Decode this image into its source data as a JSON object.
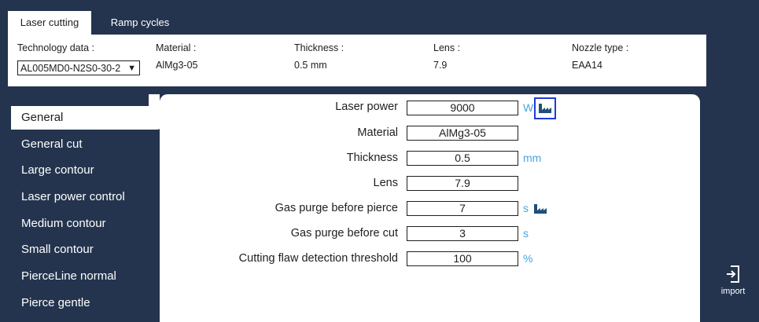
{
  "tabs": [
    {
      "label": "Laser cutting",
      "active": true
    },
    {
      "label": "Ramp cycles",
      "active": false
    }
  ],
  "technology": {
    "label": "Technology data :",
    "selected": "AL005MD0-N2S0-30-2",
    "material_label": "Material :",
    "material_value": "AlMg3-05",
    "thickness_label": "Thickness :",
    "thickness_value": "0.5 mm",
    "lens_label": "Lens :",
    "lens_value": "7.9",
    "nozzle_label": "Nozzle type :",
    "nozzle_value": "EAA14"
  },
  "sidebar": {
    "items": [
      {
        "label": "General",
        "active": true
      },
      {
        "label": "General cut"
      },
      {
        "label": "Large contour"
      },
      {
        "label": "Laser power control"
      },
      {
        "label": "Medium contour"
      },
      {
        "label": "Small contour"
      },
      {
        "label": "PierceLine normal"
      },
      {
        "label": "Pierce gentle"
      }
    ]
  },
  "parameters": [
    {
      "label": "Laser power",
      "value": "9000",
      "unit": "W",
      "icon": "factory-icon"
    },
    {
      "label": "Material",
      "value": "AlMg3-05",
      "unit": ""
    },
    {
      "label": "Thickness",
      "value": "0.5",
      "unit": "mm"
    },
    {
      "label": "Lens",
      "value": "7.9",
      "unit": ""
    },
    {
      "label": "Gas purge before pierce",
      "value": "7",
      "unit": "s",
      "icon": "factory-icon"
    },
    {
      "label": "Gas purge before cut",
      "value": "3",
      "unit": "s"
    },
    {
      "label": "Cutting flaw detection threshold",
      "value": "100",
      "unit": "%"
    }
  ],
  "actions": {
    "import_label": "import",
    "import_icon": "import-icon"
  },
  "colors": {
    "background": "#24344e",
    "accent": "#4aa3df",
    "focus_outline": "#1d3bd6"
  }
}
